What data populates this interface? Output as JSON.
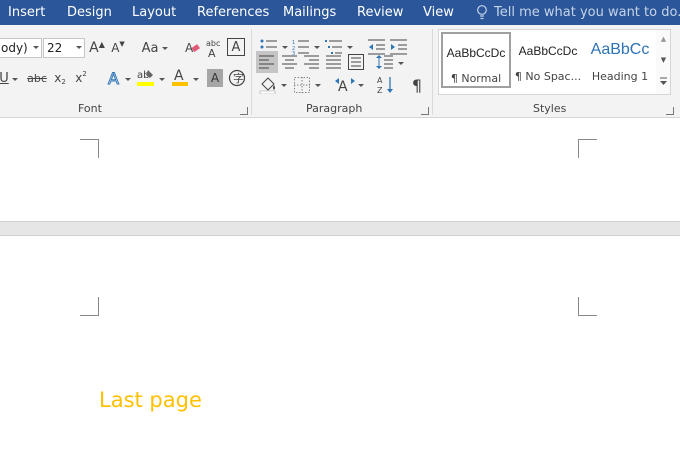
{
  "tabs": [
    "Insert",
    "Design",
    "Layout",
    "References",
    "Mailings",
    "Review",
    "View"
  ],
  "tell_me": "Tell me what you want to do...",
  "font": {
    "name_value": "ody)",
    "size_value": "22",
    "group_label": "Font"
  },
  "paragraph": {
    "group_label": "Paragraph"
  },
  "styles": {
    "group_label": "Styles",
    "items": [
      {
        "sample": "AaBbCcDc",
        "name": "¶ Normal"
      },
      {
        "sample": "AaBbCcDc",
        "name": "¶ No Spac..."
      },
      {
        "sample": "AaBbCc",
        "name": "Heading 1"
      }
    ]
  },
  "document": {
    "text": "Last page"
  },
  "colors": {
    "accent": "#2b579a",
    "text_highlight": "#ffff00",
    "font_color": "#ffc000",
    "heading": "#2e74b5"
  }
}
